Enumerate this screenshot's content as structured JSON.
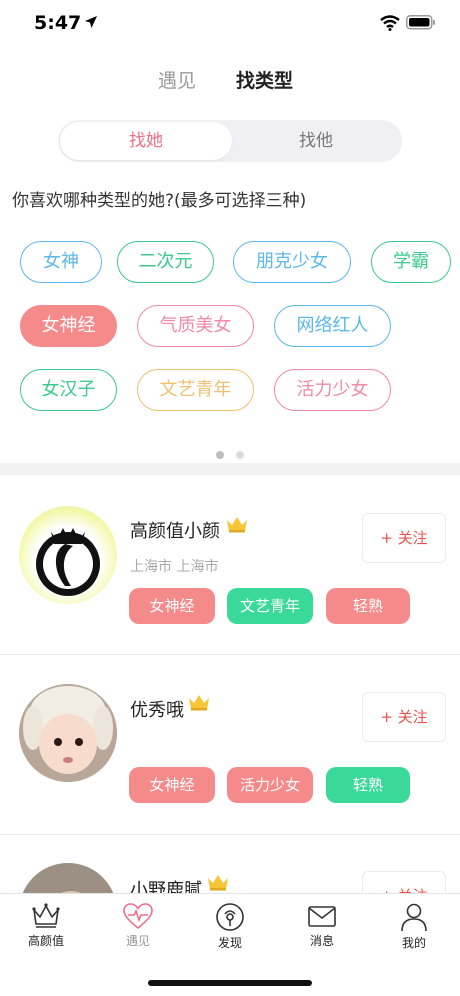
{
  "status": {
    "time": "5:47",
    "icons": [
      "location-arrow-icon",
      "wifi-icon",
      "battery-icon"
    ]
  },
  "top_tabs": [
    {
      "label": "遇见",
      "active": false
    },
    {
      "label": "找类型",
      "active": true
    }
  ],
  "segment": {
    "options": [
      "找她",
      "找他"
    ],
    "selected": "找她"
  },
  "question": "你喜欢哪种类型的她?(最多可选择三种)",
  "tags": [
    {
      "label": "女神",
      "color": "#5bb8ea",
      "selected": false
    },
    {
      "label": "二次元",
      "color": "#3bc98d",
      "selected": false
    },
    {
      "label": "朋克少女",
      "color": "#5bb8ea",
      "selected": false
    },
    {
      "label": "学霸",
      "color": "#3bc98d",
      "selected": false
    },
    {
      "label": "女神经",
      "color": "#f58a8a",
      "selected": true
    },
    {
      "label": "气质美女",
      "color": "#f08aa6",
      "selected": false
    },
    {
      "label": "网络红人",
      "color": "#5bb8ea",
      "selected": false
    },
    {
      "label": "女汉子",
      "color": "#3bc98d",
      "selected": false
    },
    {
      "label": "文艺青年",
      "color": "#f0c070",
      "selected": false
    },
    {
      "label": "活力少女",
      "color": "#f08aa6",
      "selected": false
    }
  ],
  "pager": {
    "count": 2,
    "active": 0
  },
  "users": [
    {
      "name": "高颜值小颜",
      "location": "上海市 上海市",
      "follow": "+ 关注",
      "tags": [
        {
          "label": "女神经",
          "color": "#f58a8a"
        },
        {
          "label": "文艺青年",
          "color": "#3ad99a"
        },
        {
          "label": "轻熟",
          "color": "#f58a8a"
        }
      ]
    },
    {
      "name": "优秀哦",
      "location": "",
      "follow": "+ 关注",
      "tags": [
        {
          "label": "女神经",
          "color": "#f58a8a"
        },
        {
          "label": "活力少女",
          "color": "#f58a8a"
        },
        {
          "label": "轻熟",
          "color": "#3ad99a"
        }
      ]
    },
    {
      "name": "小野鹿腻",
      "location": "",
      "follow": "+ 关注",
      "tags": []
    }
  ],
  "tabbar": [
    {
      "label": "高颜值",
      "icon": "crown-icon",
      "active": false
    },
    {
      "label": "遇见",
      "icon": "heart-pulse-icon",
      "active": true
    },
    {
      "label": "发现",
      "icon": "discover-icon",
      "active": false
    },
    {
      "label": "消息",
      "icon": "mail-icon",
      "active": false
    },
    {
      "label": "我的",
      "icon": "person-icon",
      "active": false
    }
  ]
}
